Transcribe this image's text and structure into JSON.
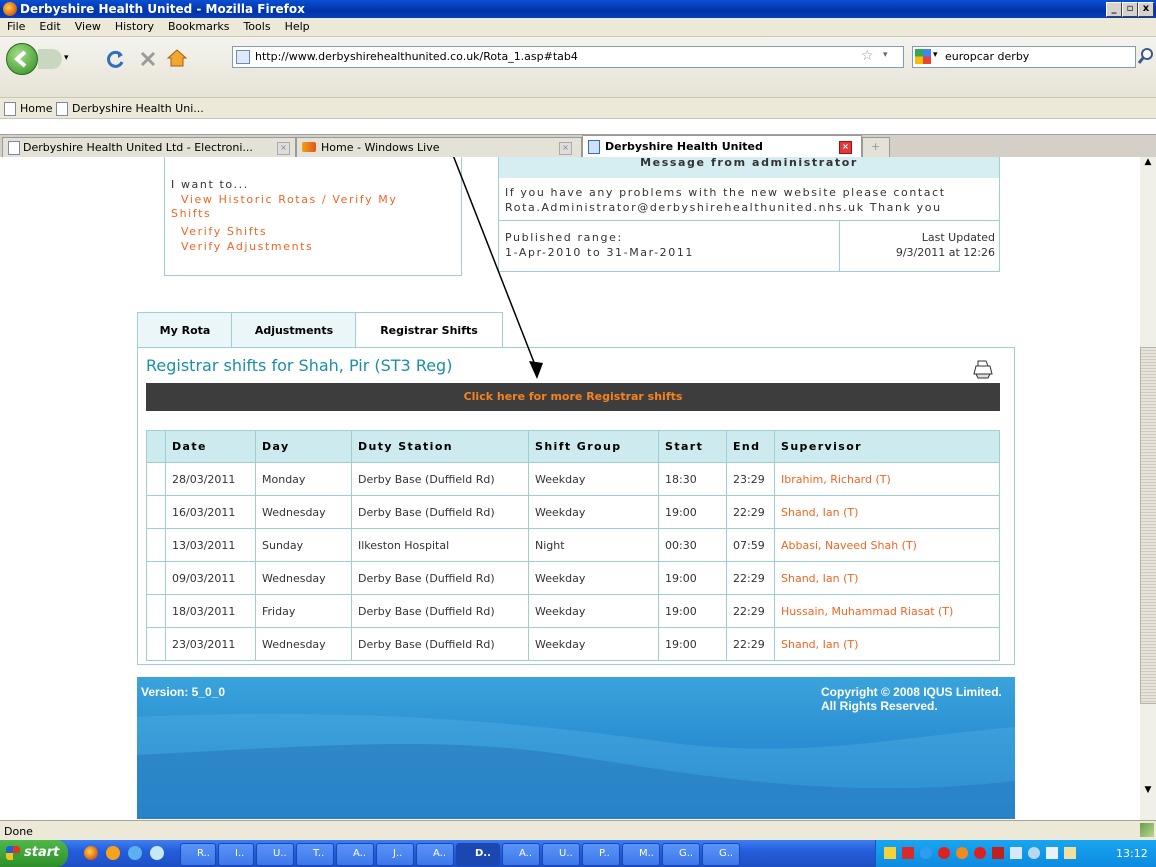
{
  "window": {
    "title": "Derbyshire Health United - Mozilla Firefox",
    "min": "_",
    "max": "▫",
    "close": "x"
  },
  "menu": [
    "File",
    "Edit",
    "View",
    "History",
    "Bookmarks",
    "Tools",
    "Help"
  ],
  "nav": {
    "url": "http://www.derbyshirehealthunited.co.uk/Rota_1.asp#tab4",
    "search": "europcar derby"
  },
  "bookmarks": [
    "Home",
    "Derbyshire Health Uni..."
  ],
  "tabs": [
    "Derbyshire Health United Ltd - Electroni...",
    "Home - Windows Live",
    "Derbyshire Health United"
  ],
  "page": {
    "iwant": {
      "heading": "I want to...",
      "link1a": "View Historic Rotas / Verify My",
      "link1b": "Shifts",
      "link2": "Verify Shifts",
      "link3": "Verify Adjustments"
    },
    "message": {
      "title": "Message from administrator",
      "line1": "If you have any problems with the new website please contact",
      "line2": "Rota.Administrator@derbyshirehealthunited.nhs.uk Thank you",
      "published_label": "Published range:",
      "published_value": "1-Apr-2010 to 31-Mar-2011",
      "updated_label": "Last Updated",
      "updated_value": "9/3/2011 at 12:26"
    },
    "rota_tabs": [
      "My Rota",
      "Adjustments",
      "Registrar Shifts"
    ],
    "heading": "Registrar shifts for Shah, Pir (ST3 Reg)",
    "more_link": "Click here for more Registrar shifts",
    "columns": [
      "Date",
      "Day",
      "Duty Station",
      "Shift Group",
      "Start",
      "End",
      "Supervisor"
    ],
    "rows": [
      [
        "28/03/2011",
        "Monday",
        "Derby Base (Duffield Rd)",
        "Weekday",
        "18:30",
        "23:29",
        "Ibrahim, Richard (T)"
      ],
      [
        "16/03/2011",
        "Wednesday",
        "Derby Base (Duffield Rd)",
        "Weekday",
        "19:00",
        "22:29",
        "Shand, Ian (T)"
      ],
      [
        "13/03/2011",
        "Sunday",
        "Ilkeston Hospital",
        "Night",
        "00:30",
        "07:59",
        "Abbasi, Naveed Shah (T)"
      ],
      [
        "09/03/2011",
        "Wednesday",
        "Derby Base (Duffield Rd)",
        "Weekday",
        "19:00",
        "22:29",
        "Shand, Ian (T)"
      ],
      [
        "18/03/2011",
        "Friday",
        "Derby Base (Duffield Rd)",
        "Weekday",
        "19:00",
        "22:29",
        "Hussain, Muhammad Riasat (T)"
      ],
      [
        "23/03/2011",
        "Wednesday",
        "Derby Base (Duffield Rd)",
        "Weekday",
        "19:00",
        "22:29",
        "Shand, Ian (T)"
      ]
    ],
    "footer": {
      "version": "Version: 5_0_0",
      "copyright1": "Copyright © 2008 IQUS Limited.",
      "copyright2": "All Rights Reserved."
    }
  },
  "status": "Done",
  "taskbar": {
    "start": "start",
    "clock": "13:12",
    "items": [
      "R..",
      "I..",
      "U..",
      "T..",
      "A..",
      "J..",
      "A..",
      "D..",
      "A..",
      "U..",
      "P..",
      "M..",
      "G..",
      "G.."
    ]
  }
}
